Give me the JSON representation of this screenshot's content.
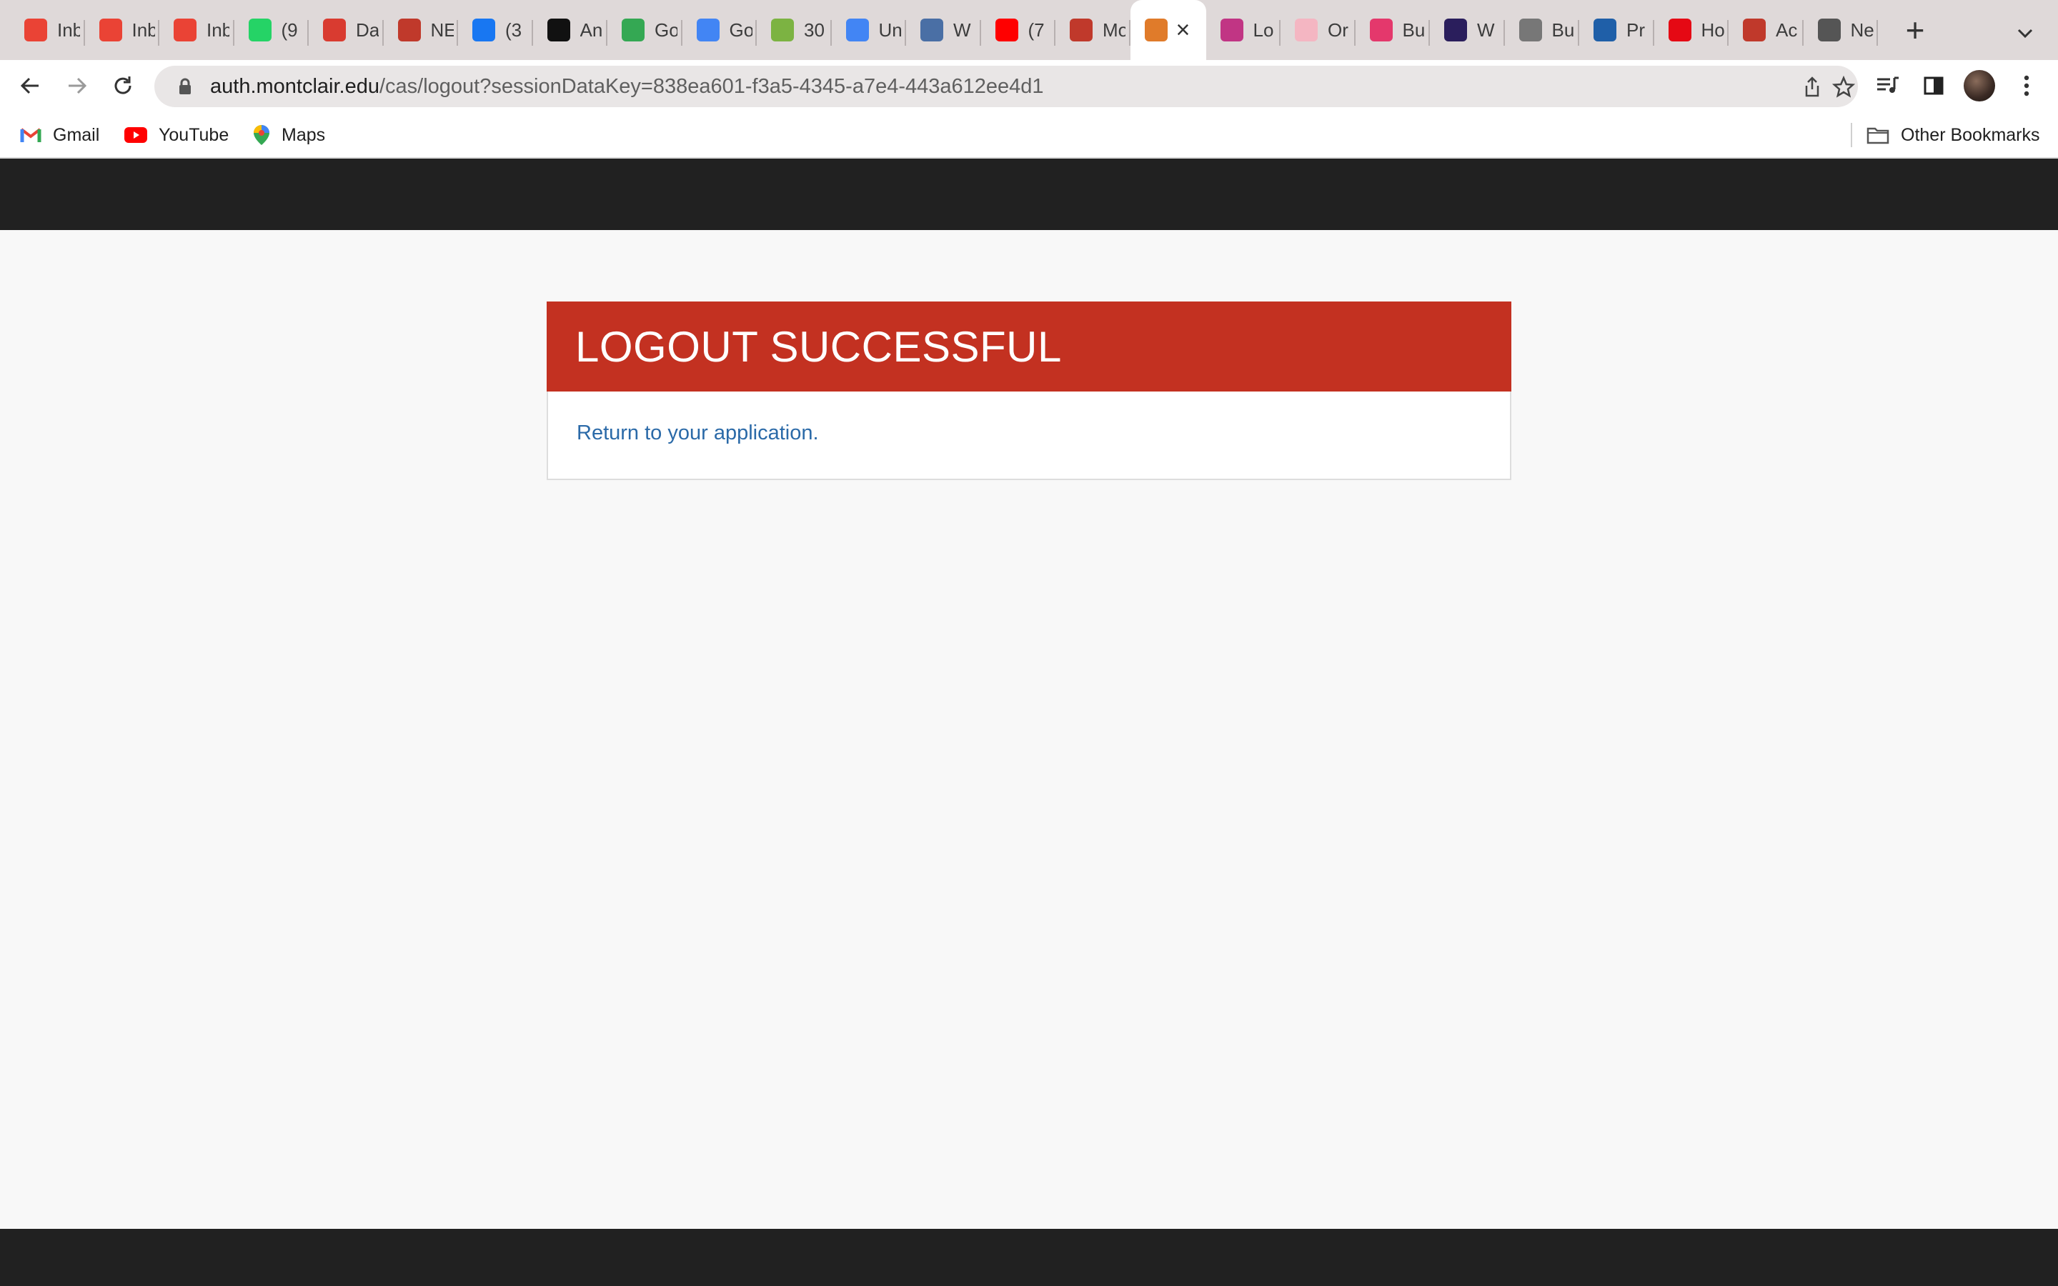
{
  "browser": {
    "tabs": [
      {
        "title": "Inbox",
        "favicon": "gmail-icon",
        "color": "#ea4335"
      },
      {
        "title": "Inbox",
        "favicon": "gmail-icon",
        "color": "#ea4335"
      },
      {
        "title": "Inbox",
        "favicon": "gmail-icon",
        "color": "#ea4335"
      },
      {
        "title": "(9",
        "favicon": "whatsapp-icon",
        "color": "#25d366"
      },
      {
        "title": "Da",
        "favicon": "sun-icon",
        "color": "#d93b30"
      },
      {
        "title": "NE",
        "favicon": "shield-icon",
        "color": "#c0392b"
      },
      {
        "title": "(3",
        "favicon": "facebook-icon",
        "color": "#1877f2"
      },
      {
        "title": "An",
        "favicon": "amazon-icon",
        "color": "#111111"
      },
      {
        "title": "Go",
        "favicon": "sheets-icon",
        "color": "#34a853"
      },
      {
        "title": "Go",
        "favicon": "maps-icon",
        "color": "#4285f4"
      },
      {
        "title": "30",
        "favicon": "recycle-icon",
        "color": "#7cb342"
      },
      {
        "title": "Un",
        "favicon": "docs-icon",
        "color": "#4285f4"
      },
      {
        "title": "W",
        "favicon": "mp-icon",
        "color": "#4a6fa5"
      },
      {
        "title": "(7",
        "favicon": "youtube-icon",
        "color": "#ff0000"
      },
      {
        "title": "Mo",
        "favicon": "shield-icon",
        "color": "#c0392b"
      },
      {
        "title": "",
        "favicon": "cas-icon",
        "color": "#e07b2a",
        "active": true
      },
      {
        "title": "Lo",
        "favicon": "instagram-icon",
        "color": "#c13584"
      },
      {
        "title": "Or",
        "favicon": "smiley-icon",
        "color": "#f4b6c2"
      },
      {
        "title": "Bu",
        "favicon": "myntra-icon",
        "color": "#e4386c"
      },
      {
        "title": "W",
        "favicon": "voot-icon",
        "color": "#2a1e5c"
      },
      {
        "title": "Bu",
        "favicon": "owl-icon",
        "color": "#777777"
      },
      {
        "title": "Pr",
        "favicon": "play-icon",
        "color": "#1f5fa8"
      },
      {
        "title": "Ho",
        "favicon": "netflix-icon",
        "color": "#e50914"
      },
      {
        "title": "Ac",
        "favicon": "shield-icon",
        "color": "#c0392b"
      },
      {
        "title": "Ne",
        "favicon": "chrome-icon",
        "color": "#555555"
      }
    ],
    "url_host": "auth.montclair.edu",
    "url_path": "/cas/logout?sessionDataKey=838ea601-f3a5-4345-a7e4-443a612ee4d1",
    "bookmarks": [
      {
        "label": "Gmail",
        "icon": "gmail-icon"
      },
      {
        "label": "YouTube",
        "icon": "youtube-icon"
      },
      {
        "label": "Maps",
        "icon": "maps-pin-icon"
      }
    ],
    "other_bookmarks": "Other Bookmarks"
  },
  "page": {
    "title": "LOGOUT SUCCESSFUL",
    "return_link": "Return to your application.",
    "colors": {
      "header_bar": "#212121",
      "banner": "#c33121",
      "link": "#2b6aa8",
      "background": "#f8f8f8"
    }
  }
}
